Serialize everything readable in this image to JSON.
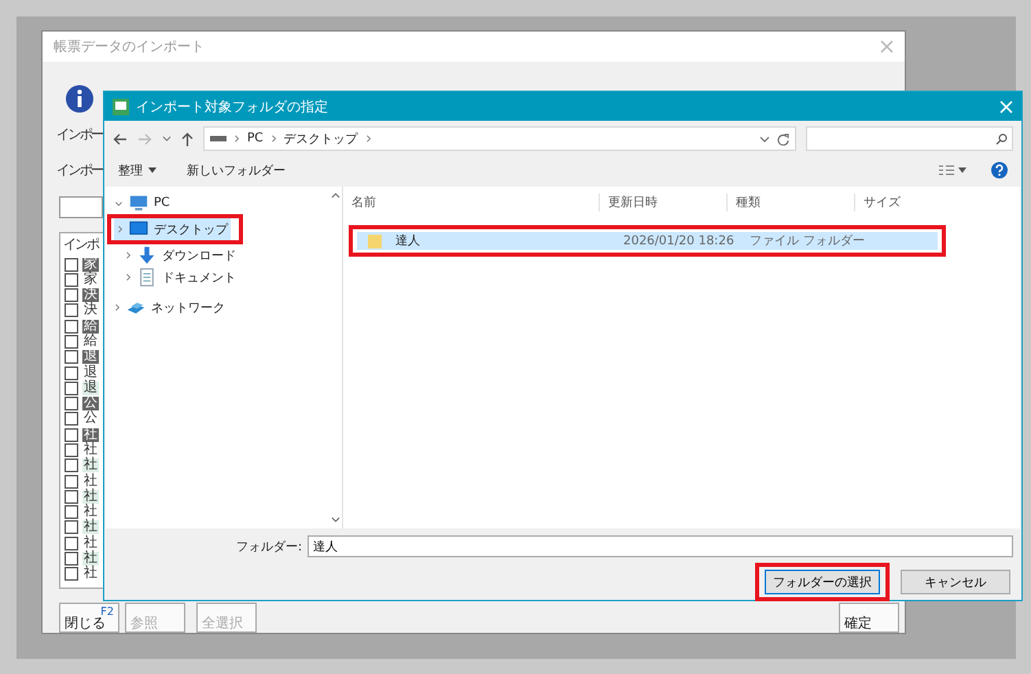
{
  "background_window": {
    "title": "帳票データのインポート",
    "labels": [
      "インポー",
      "インポー"
    ],
    "list_header": "インポ",
    "list_items": [
      {
        "text": "家",
        "kind": "dark",
        "checked": false
      },
      {
        "text": "家",
        "kind": "plain",
        "checked": false
      },
      {
        "text": "決",
        "kind": "dark",
        "checked": false
      },
      {
        "text": "決",
        "kind": "plain",
        "checked": false
      },
      {
        "text": "給",
        "kind": "dark",
        "checked": false
      },
      {
        "text": "給",
        "kind": "plain",
        "checked": false
      },
      {
        "text": "退",
        "kind": "dark",
        "checked": false
      },
      {
        "text": "退",
        "kind": "plain",
        "checked": false
      },
      {
        "text": "退",
        "kind": "light",
        "checked": false
      },
      {
        "text": "公",
        "kind": "dark",
        "checked": false
      },
      {
        "text": "公",
        "kind": "plain",
        "checked": false
      },
      {
        "text": "社",
        "kind": "dark",
        "checked": false
      },
      {
        "text": "社",
        "kind": "plain",
        "checked": false
      },
      {
        "text": "社",
        "kind": "light",
        "checked": false
      },
      {
        "text": "社",
        "kind": "plain",
        "checked": false
      },
      {
        "text": "社",
        "kind": "light",
        "checked": false
      },
      {
        "text": "社",
        "kind": "plain",
        "checked": false
      },
      {
        "text": "社",
        "kind": "light",
        "checked": false
      },
      {
        "text": "社",
        "kind": "plain",
        "checked": false
      },
      {
        "text": "社",
        "kind": "light",
        "checked": false
      },
      {
        "text": "社",
        "kind": "plain",
        "checked": false
      }
    ],
    "function_keys": [
      {
        "key": "F2",
        "label": "閉じる",
        "disabled": false
      },
      {
        "label": "参照",
        "disabled": true
      },
      {
        "label": "全選択",
        "disabled": true
      },
      {
        "label": "確定",
        "disabled": false
      }
    ]
  },
  "dialog": {
    "title": "インポート対象フォルダの指定",
    "breadcrumb": [
      "PC",
      "デスクトップ"
    ],
    "toolbar": [
      {
        "label": "整理",
        "dropdown": true
      },
      {
        "label": "新しいフォルダー",
        "dropdown": false
      }
    ],
    "nav_items": [
      {
        "label": "PC",
        "kind": "pc",
        "expanded": true,
        "selected": false,
        "highlighted": false,
        "children": [
          {
            "label": "デスクトップ",
            "kind": "desktop",
            "expanded": false,
            "selected": true,
            "highlighted": true
          },
          {
            "label": "ダウンロード",
            "kind": "download",
            "expanded": false,
            "selected": false,
            "highlighted": false
          },
          {
            "label": "ドキュメント",
            "kind": "document",
            "expanded": false,
            "selected": false,
            "highlighted": false
          }
        ]
      },
      {
        "label": "ネットワーク",
        "kind": "network",
        "expanded": false,
        "selected": false,
        "highlighted": false
      }
    ],
    "columns": [
      "名前",
      "更新日時",
      "種類",
      "サイズ"
    ],
    "rows": [
      {
        "name": "達人",
        "modified": "2026/01/20 18:26",
        "type": "ファイル フォルダー",
        "selected": true,
        "highlighted": true
      }
    ],
    "folder_label": "フォルダー:",
    "folder_value": "達人",
    "buttons": [
      {
        "label": "フォルダーの選択",
        "default": true,
        "highlighted": true
      },
      {
        "label": "キャンセル",
        "default": false,
        "highlighted": false
      }
    ]
  }
}
